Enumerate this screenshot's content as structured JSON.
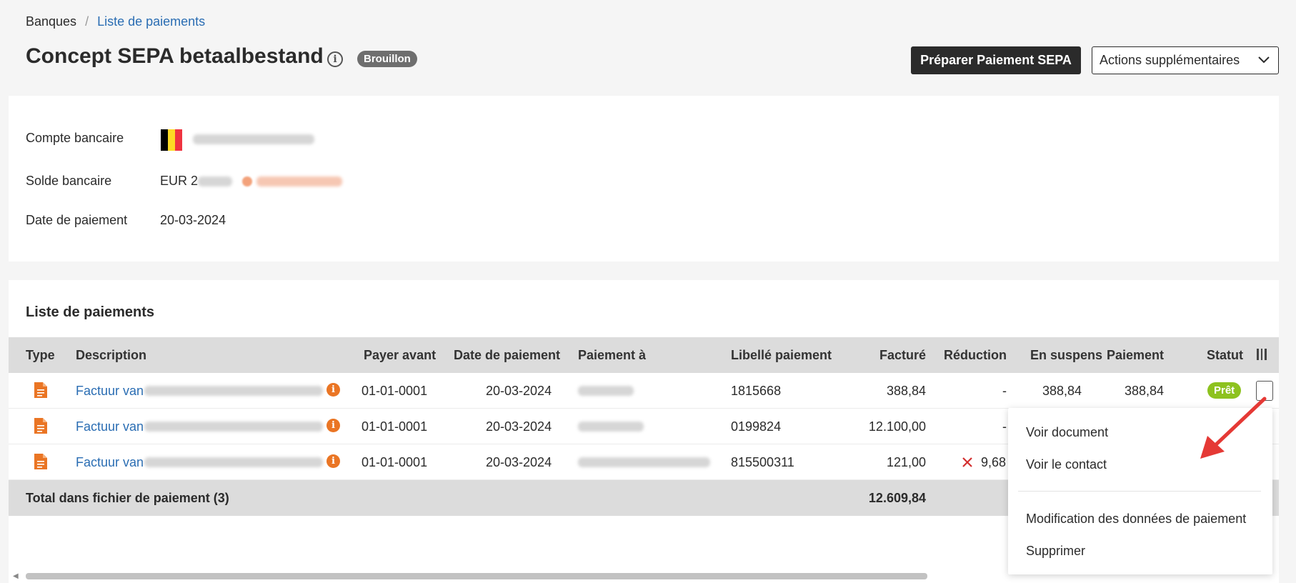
{
  "breadcrumb": {
    "root": "Banques",
    "separator": "/",
    "current": "Liste de paiements"
  },
  "header": {
    "title": "Concept SEPA betaalbestand",
    "status_badge": "Brouillon",
    "primary_button": "Préparer Paiement SEPA",
    "secondary_button": "Actions supplémentaires"
  },
  "info": {
    "account_label": "Compte bancaire",
    "balance_label": "Solde bancaire",
    "balance_prefix": "EUR 2",
    "date_label": "Date de paiement",
    "date_value": "20-03-2024",
    "flag_colors": [
      "#000000",
      "#FDDA24",
      "#EF3340"
    ]
  },
  "payments": {
    "title": "Liste de paiements",
    "columns": {
      "type": "Type",
      "description": "Description",
      "pay_before": "Payer avant",
      "payment_date": "Date de paiement",
      "payment_to": "Paiement à",
      "payment_label": "Libellé paiement",
      "invoiced": "Facturé",
      "discount": "Réduction",
      "pending": "En suspens",
      "payment": "Paiement",
      "status": "Statut"
    },
    "rows": [
      {
        "description": "Factuur van",
        "pay_before": "01-01-0001",
        "payment_date": "20-03-2024",
        "payment_label": "1815668",
        "invoiced": "388,84",
        "discount": "-",
        "pending": "388,84",
        "payment": "388,84",
        "status": "Prêt"
      },
      {
        "description": "Factuur van",
        "pay_before": "01-01-0001",
        "payment_date": "20-03-2024",
        "payment_label": "0199824",
        "invoiced": "12.100,00",
        "discount": "-"
      },
      {
        "description": "Factuur van",
        "pay_before": "01-01-0001",
        "payment_date": "20-03-2024",
        "payment_label": "815500311",
        "invoiced": "121,00",
        "discount": "9,68"
      }
    ],
    "total": {
      "label": "Total dans fichier de paiement (3)",
      "invoiced": "12.609,84"
    }
  },
  "context_menu": {
    "items": [
      "Voir document",
      "Voir le contact",
      "Modification des données de paiement",
      "Supprimer"
    ]
  },
  "colors": {
    "link": "#2a6db3",
    "accent_orange": "#ea7524",
    "ready_green": "#8dc21f",
    "annotation_red": "#e53935"
  }
}
